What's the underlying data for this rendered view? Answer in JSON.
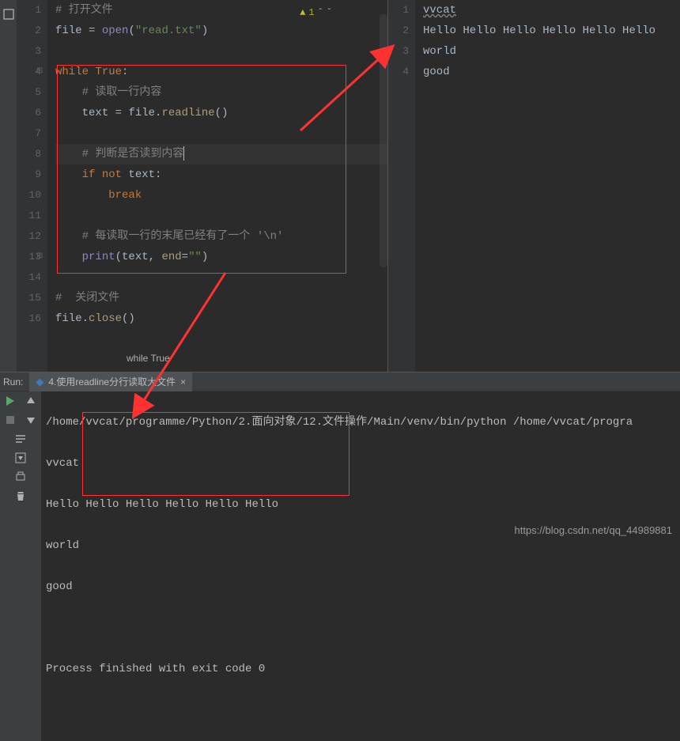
{
  "editor": {
    "warnings": {
      "count": "1"
    },
    "breadcrumb": "while True",
    "lines": {
      "l1": {
        "n": "1",
        "indent": "",
        "comment": "# 打开文件"
      },
      "l2": {
        "n": "2",
        "indent": "",
        "a": "file",
        "eq": " = ",
        "fn": "open",
        "p1": "(",
        "s": "\"read.txt\"",
        "p2": ")"
      },
      "l3": {
        "n": "3"
      },
      "l4": {
        "n": "4",
        "indent": "",
        "kw": "while ",
        "const": "True",
        "colon": ":"
      },
      "l5": {
        "n": "5",
        "indent": "    ",
        "comment": "# 读取一行内容"
      },
      "l6": {
        "n": "6",
        "indent": "    ",
        "a": "text",
        "eq": " = ",
        "b": "file",
        "dot": ".",
        "m": "readline",
        "pp": "()"
      },
      "l7": {
        "n": "7"
      },
      "l8": {
        "n": "8",
        "indent": "    ",
        "comment": "# 判断是否读到内容"
      },
      "l9": {
        "n": "9",
        "indent": "    ",
        "kw": "if not ",
        "a": "text",
        "colon": ":"
      },
      "l10": {
        "n": "10",
        "indent": "        ",
        "kw": "break"
      },
      "l11": {
        "n": "11"
      },
      "l12": {
        "n": "12",
        "indent": "    ",
        "comment": "# 每读取一行的末尾已经有了一个 '\\n'"
      },
      "l13": {
        "n": "13",
        "indent": "    ",
        "fn": "print",
        "p1": "(",
        "a": "text",
        "comma": ", ",
        "kwarg": "end",
        "eq2": "=",
        "s": "\"\"",
        "p2": ")"
      },
      "l14": {
        "n": "14"
      },
      "l15": {
        "n": "15",
        "indent": "",
        "comment": "#  关闭文件"
      },
      "l16": {
        "n": "16",
        "indent": "",
        "a": "file",
        "dot": ".",
        "m": "close",
        "pp": "()"
      }
    }
  },
  "preview": {
    "lines": {
      "p1": {
        "n": "1",
        "text": "vvcat"
      },
      "p2": {
        "n": "2",
        "text": "Hello Hello Hello Hello Hello Hello"
      },
      "p3": {
        "n": "3",
        "text": "world"
      },
      "p4": {
        "n": "4",
        "text": "good"
      }
    }
  },
  "run": {
    "label": "Run:",
    "tab": "4.使用readline分行读取大文件",
    "cmd": "/home/vvcat/programme/Python/2.面向对象/12.文件操作/Main/venv/bin/python /home/vvcat/progra",
    "out1": "vvcat",
    "out2": "Hello Hello Hello Hello Hello Hello",
    "out3": "world",
    "out4": "good",
    "blank": " ",
    "exit": "Process finished with exit code 0"
  },
  "watermark": "https://blog.csdn.net/qq_44989881"
}
